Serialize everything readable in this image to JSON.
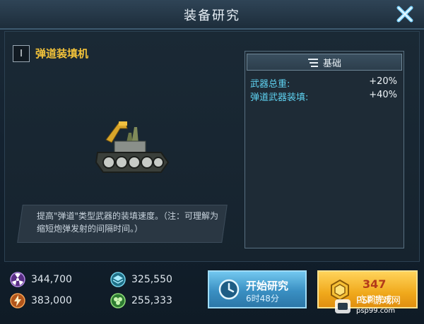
{
  "window": {
    "title": "装备研究"
  },
  "item": {
    "grade": "I",
    "name": "弹道装填机",
    "description": "提高\"弹道\"类型武器的装填速度。（注：可理解为缩短炮弹发射的间隔时间。）"
  },
  "stats": {
    "header": "基础",
    "rows": [
      {
        "label": "武器总重:",
        "value": "+20%"
      },
      {
        "label": "弹道武器装填:",
        "value": "+40%"
      }
    ]
  },
  "resources": [
    {
      "icon": "radiation-icon",
      "value": "344,700"
    },
    {
      "icon": "layers-icon",
      "value": "325,550"
    },
    {
      "icon": "energy-icon",
      "value": "383,000"
    },
    {
      "icon": "organic-icon",
      "value": "255,333"
    }
  ],
  "actions": {
    "start_label": "开始研究",
    "start_time": "6时48分",
    "finish_cost": "347",
    "finish_label": "立即完成"
  },
  "watermark": {
    "brand": "PSP游戏网",
    "url": "psp99.com"
  }
}
